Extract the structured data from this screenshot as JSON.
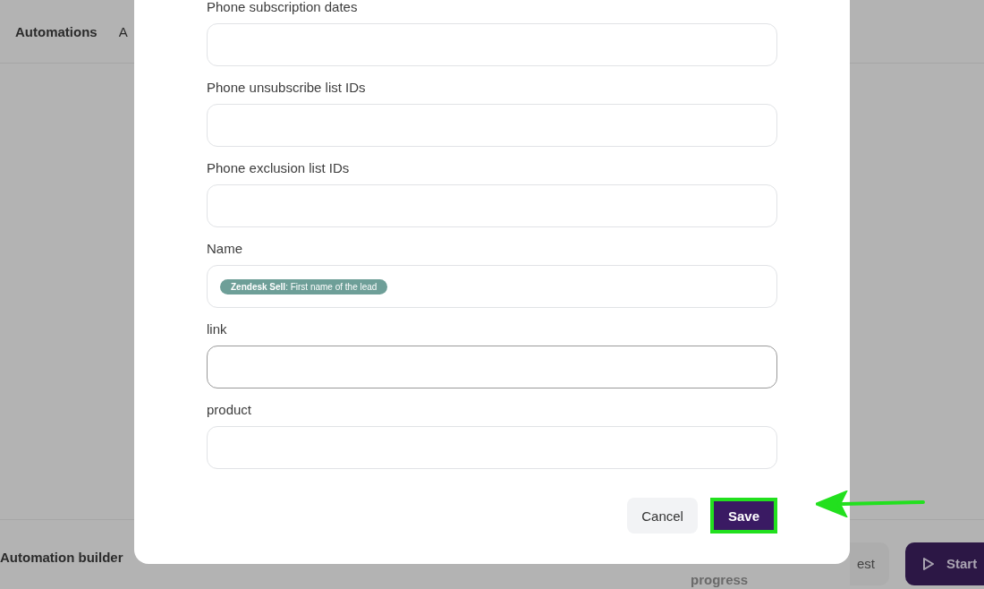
{
  "top_bar": {
    "tabs": [
      {
        "label": "Automations",
        "selected": true
      },
      {
        "label": "A",
        "selected": false
      }
    ]
  },
  "bottom_bar": {
    "title": "Automation builder",
    "status": "progress",
    "test_button": "est",
    "start_button": "Start"
  },
  "dialog": {
    "fields": [
      {
        "label": "Phone subscription dates",
        "focused": false
      },
      {
        "label": "Phone unsubscribe list IDs",
        "focused": false
      },
      {
        "label": "Phone exclusion list IDs",
        "focused": false
      },
      {
        "label": "Name",
        "tag": "**Zendesk Sell**: First name of the lead",
        "focused": false
      },
      {
        "label": "link",
        "focused": true
      },
      {
        "label": "product",
        "focused": false
      }
    ],
    "cancel": "Cancel",
    "save": "Save",
    "save_highlighted": true
  }
}
